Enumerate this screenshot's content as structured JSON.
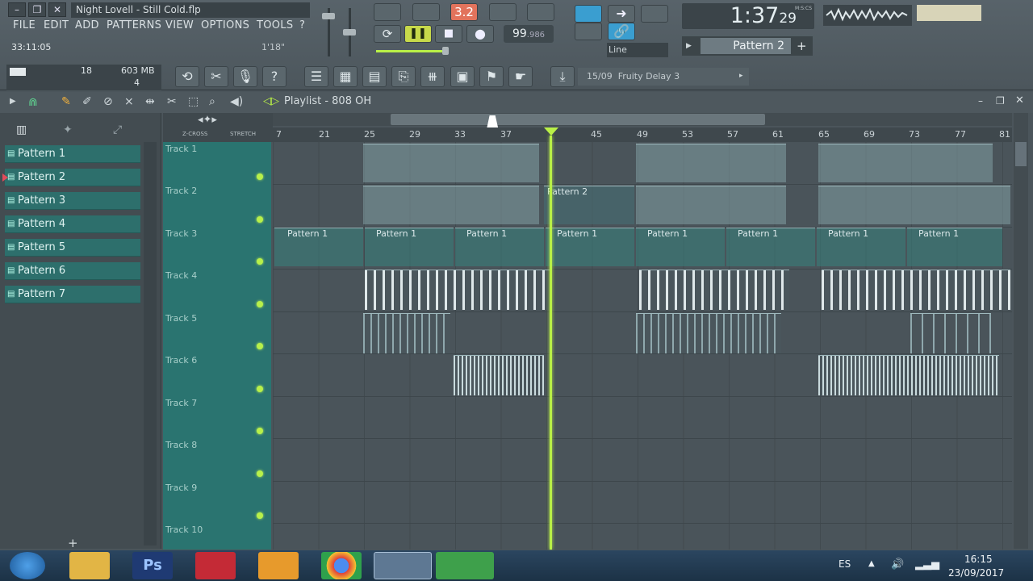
{
  "window": {
    "title": "Night Lovell - Still Cold.flp",
    "menu": [
      "FILE",
      "EDIT",
      "ADD",
      "PATTERNS",
      "VIEW",
      "OPTIONS",
      "TOOLS",
      "?"
    ],
    "hint_time": "33:11:05",
    "hint_length": "1'18\""
  },
  "transport": {
    "tempo": "99",
    "tempo_fraction": ".986",
    "pattern_mode_label": "3.2",
    "clock": "1:37",
    "clock_sub": "29",
    "clock_label": "M:S:CS",
    "snap": "Line",
    "current_pattern": "Pattern 2"
  },
  "stats": {
    "cpu": "18",
    "memory": "603 MB",
    "polyphony": "4"
  },
  "hint_bar": {
    "index": "15/09",
    "text": "Fruity Delay 3"
  },
  "playlist": {
    "title": "Playlist - 808 OH",
    "ruler": [
      "7",
      "21",
      "25",
      "29",
      "33",
      "37",
      "45",
      "49",
      "53",
      "57",
      "61",
      "65",
      "69",
      "73",
      "77",
      "81"
    ],
    "xcross": "Z-CROSS",
    "stretch": "STRETCH",
    "patterns": [
      "Pattern 1",
      "Pattern 2",
      "Pattern 3",
      "Pattern 4",
      "Pattern 5",
      "Pattern 6",
      "Pattern 7"
    ],
    "tracks": [
      "Track 1",
      "Track 2",
      "Track 3",
      "Track 4",
      "Track 5",
      "Track 6",
      "Track 7",
      "Track 8",
      "Track 9",
      "Track 10"
    ],
    "clip_labels": {
      "pattern1": "Pattern 1",
      "pattern2": "Pattern 2"
    }
  },
  "taskbar": {
    "lang": "ES",
    "time": "16:15",
    "date": "23/09/2017"
  }
}
